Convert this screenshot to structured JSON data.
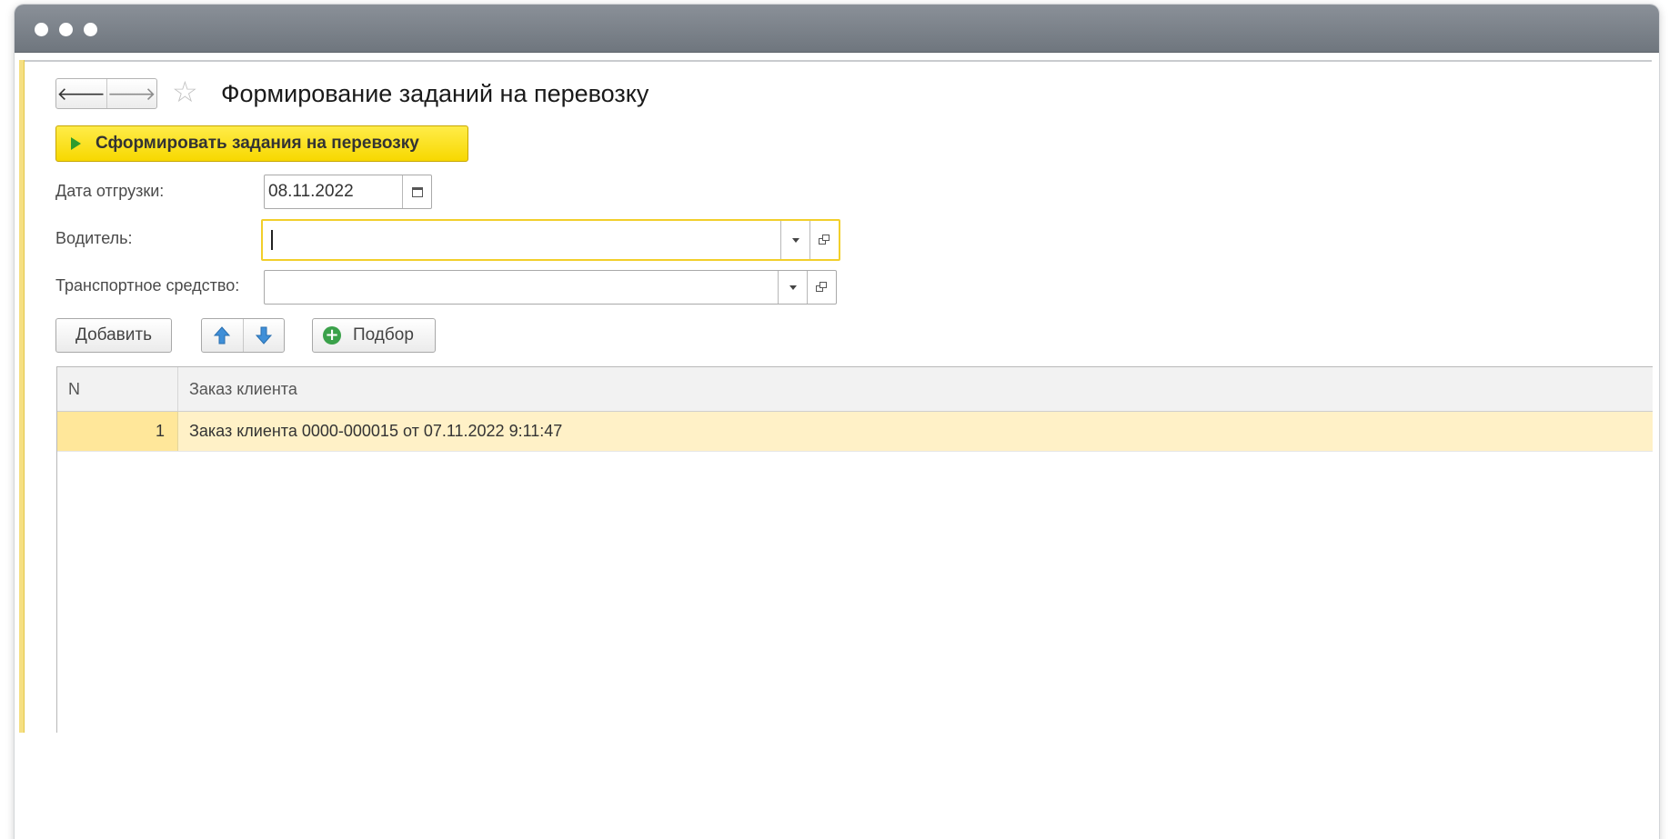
{
  "window": {
    "title_dots": [
      "close",
      "minimize",
      "maximize"
    ]
  },
  "header": {
    "back_icon": "arrow-left-icon",
    "forward_icon": "arrow-right-icon",
    "favorite_icon": "star-icon",
    "back_glyph": "🡐",
    "forward_glyph": "🡒",
    "star_glyph": "☆",
    "title": "Формирование заданий на перевозку"
  },
  "actions": {
    "primary_label": "Сформировать задания на перевозку"
  },
  "fields": {
    "date_label": "Дата отгрузки:",
    "date_value": "08.11.2022",
    "driver_label": "Водитель:",
    "driver_value": "",
    "vehicle_label": "Транспортное средство:",
    "vehicle_value": ""
  },
  "toolbar": {
    "add_label": "Добавить",
    "select_label": "Подбор",
    "plus_glyph": "+"
  },
  "table": {
    "columns": [
      "N",
      "Заказ клиента"
    ],
    "rows": [
      {
        "n": "1",
        "order": "Заказ клиента 0000-000015 от 07.11.2022 9:11:47"
      }
    ]
  },
  "colors": {
    "accent_yellow": "#f7d800",
    "focus_border": "#f2cf2b",
    "selected_row": "#fff1c7",
    "play_green": "#2e9c2e",
    "arrow_blue": "#3f8fd8"
  }
}
